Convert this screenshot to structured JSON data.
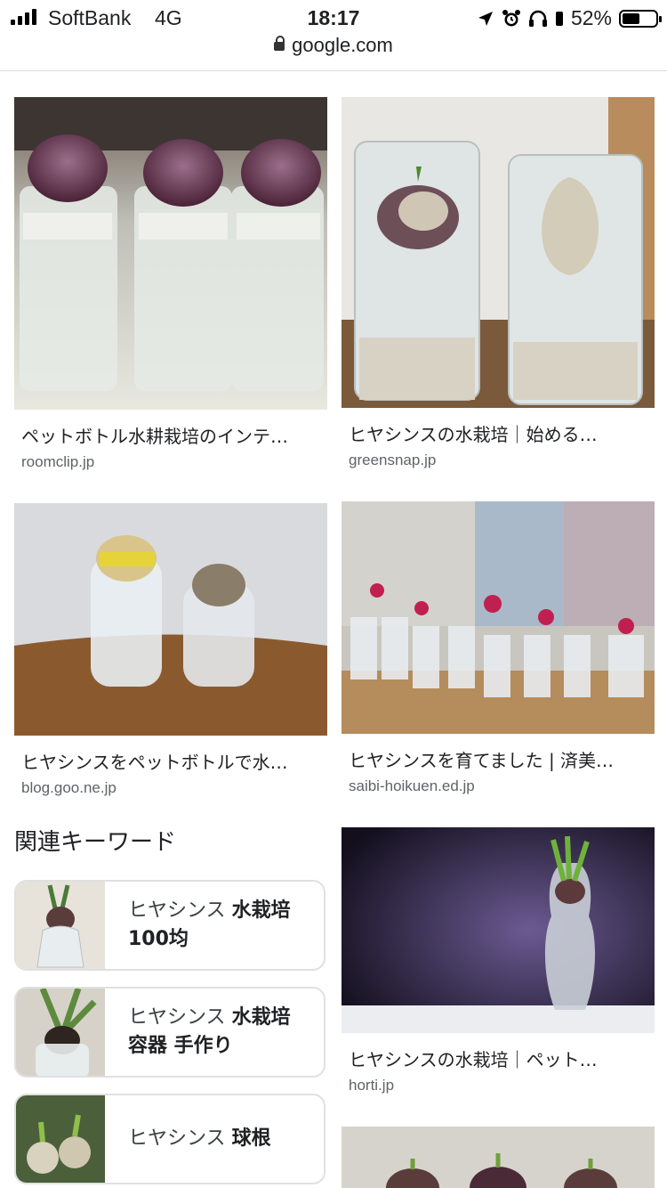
{
  "status_bar": {
    "carrier": "SoftBank",
    "network": "4G",
    "time": "18:17",
    "battery": "52%",
    "battery_level": 0.52,
    "icons": [
      "signal-icon",
      "location-icon",
      "alarm-icon",
      "headphones-icon",
      "battery-icon"
    ]
  },
  "address_bar": {
    "domain": "google.com"
  },
  "results": [
    {
      "title": "ペットボトル水耕栽培のインテ…",
      "site": "roomclip.jp"
    },
    {
      "title": "ヒヤシンスの水栽培｜始める…",
      "site": "greensnap.jp"
    },
    {
      "title": "ヒヤシンスをペットボトルで水…",
      "site": "blog.goo.ne.jp"
    },
    {
      "title": "ヒヤシンスを育てました | 済美…",
      "site": "saibi-hoikuen.ed.jp"
    },
    {
      "title": "ヒヤシンスの水栽培｜ペット…",
      "site": "horti.jp"
    }
  ],
  "related": {
    "heading": "関連キーワード",
    "items": [
      {
        "plain": "ヒヤシンス ",
        "bold": "水栽培 100均"
      },
      {
        "plain": "ヒヤシンス ",
        "bold": "水栽培 容器 手作り"
      },
      {
        "plain": "ヒヤシンス ",
        "bold": "球根"
      }
    ]
  }
}
